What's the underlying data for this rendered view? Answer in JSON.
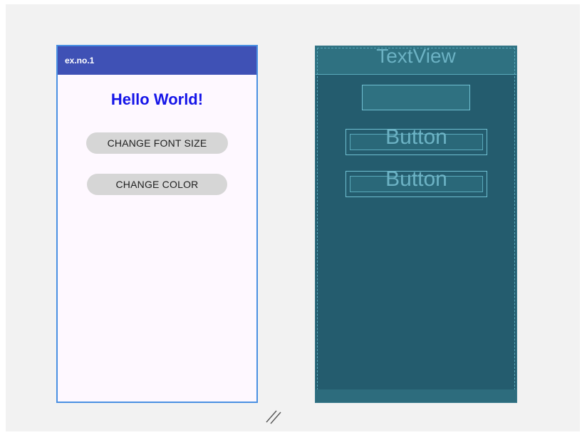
{
  "design": {
    "app_title": "ex.no.1",
    "hello_text": "Hello World!",
    "button_font_size": "CHANGE FONT SIZE",
    "button_color": "CHANGE COLOR"
  },
  "blueprint": {
    "textview_label": "TextView",
    "button1_label": "Button",
    "button2_label": "Button"
  },
  "colors": {
    "app_bar": "#3f51b5",
    "hello_text": "#1515e8",
    "blueprint_bg": "#245c6e"
  },
  "icons": {
    "resize": "resize-handle-icon"
  }
}
